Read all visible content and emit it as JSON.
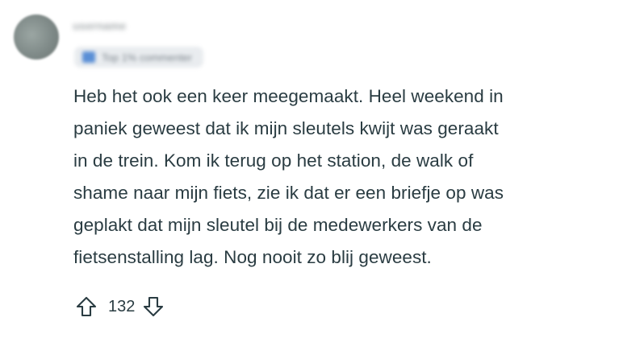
{
  "comment": {
    "author": "username",
    "flair": "Top 1% commenter",
    "body_lines": [
      "Heb het ook een keer meegemaakt. Heel weekend in",
      "paniek geweest dat ik mijn sleutels kwijt was geraakt",
      "in de trein. Kom ik terug op het station, de walk of",
      "shame naar mijn fiets, zie ik dat er een briefje op was",
      "geplakt dat mijn sleutel bij de medewerkers van de",
      "fietsenstalling lag. Nog nooit zo blij geweest."
    ],
    "score": "132"
  },
  "icons": {
    "avatar": "user-avatar",
    "upvote": "arrow-up-icon",
    "downvote": "arrow-down-icon",
    "flair": "flair-icon"
  },
  "colors": {
    "text": "#2a3c42",
    "flair_bg": "#e9ecef",
    "flair_icon": "#5a8fd6"
  }
}
